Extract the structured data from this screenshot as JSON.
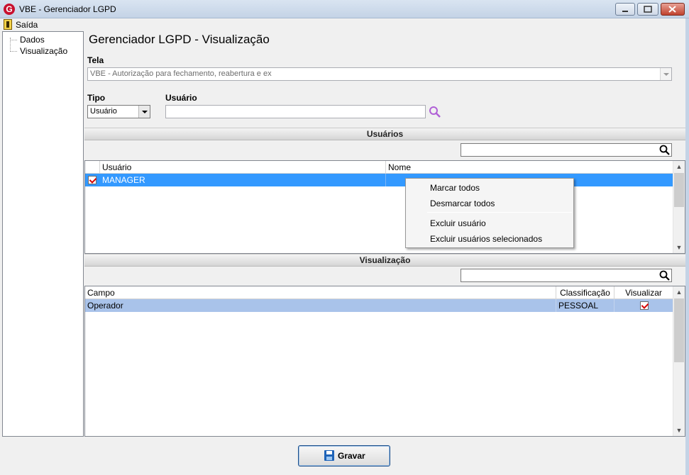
{
  "window": {
    "title": "VBE - Gerenciador LGPD",
    "app_icon": "G"
  },
  "menu": {
    "exit_label": "Saída"
  },
  "tree": {
    "items": [
      "Dados",
      "Visualização"
    ]
  },
  "page_title": "Gerenciador LGPD - Visualização",
  "tela": {
    "label": "Tela",
    "value": "VBE - Autorização para fechamento, reabertura e ex"
  },
  "tipo": {
    "label": "Tipo",
    "value": "Usuário"
  },
  "usuario": {
    "label": "Usuário",
    "value": ""
  },
  "usuarios_section": {
    "title": "Usuários",
    "filter_value": "",
    "columns": [
      "Usuário",
      "Nome"
    ],
    "rows": [
      {
        "checked": true,
        "usuario": "MANAGER",
        "nome": ""
      }
    ]
  },
  "context_menu": {
    "items": [
      "Marcar todos",
      "Desmarcar todos",
      "Excluir usuário",
      "Excluir usuários selecionados"
    ]
  },
  "visualizacao_section": {
    "title": "Visualização",
    "filter_value": "",
    "columns": [
      "Campo",
      "Classificação",
      "Visualizar"
    ],
    "rows": [
      {
        "campo": "Operador",
        "classificacao": "PESSOAL",
        "visualizar": true
      }
    ]
  },
  "buttons": {
    "save_label": "Gravar"
  },
  "colors": {
    "selection": "#3399ff",
    "row_highlight": "#a9c3ea",
    "search_accent": "#b05fd6"
  }
}
